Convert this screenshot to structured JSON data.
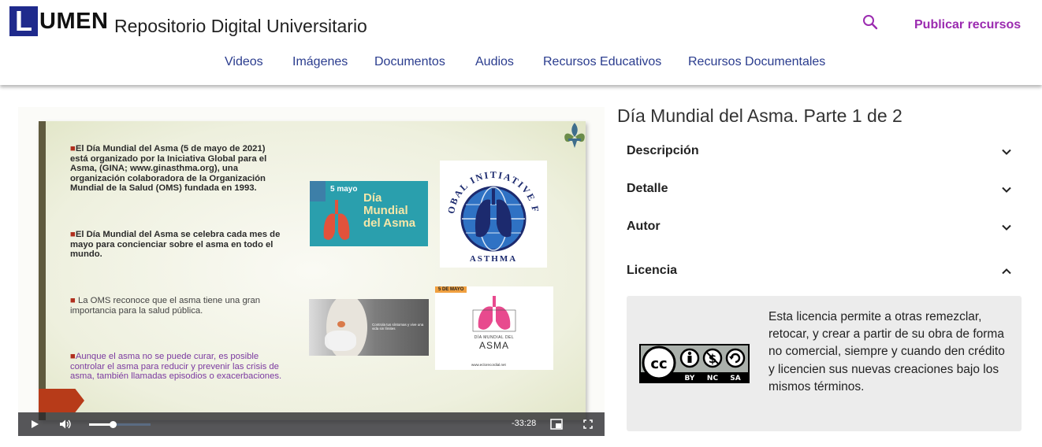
{
  "header": {
    "logo_letter": "L",
    "logo_rest": "UMEN",
    "site_title": "Repositorio Digital Universitario",
    "search_icon": "search-icon",
    "publish_label": "Publicar recursos",
    "brand_color": "#1f2a8c",
    "accent_color": "#9b2bb0"
  },
  "nav": {
    "items": [
      {
        "label": "Videos"
      },
      {
        "label": "Imágenes"
      },
      {
        "label": "Documentos"
      },
      {
        "label": "Audios"
      },
      {
        "label": "Recursos Educativos"
      },
      {
        "label": "Recursos Documentales"
      }
    ]
  },
  "video": {
    "slide": {
      "bullets": [
        "El Día Mundial del Asma (5 de mayo de 2021) está organizado por la Iniciativa Global para el Asma, (GINA; www.ginasthma.org), una organización colaboradora de la Organización Mundial de la Salud (OMS) fundada en 1993.",
        "El Día Mundial del Asma se celebra cada mes de mayo para concienciar sobre el asma en todo el mundo.",
        "La OMS reconoce que el asma tiene una gran importancia para la salud pública.",
        "Aunque el asma no se puede curar, es posible controlar el asma para reducir y prevenir las crisis de asma, también llamadas episodios o exacerbaciones."
      ],
      "poster_date": "5 mayo",
      "poster_title_1": "Día",
      "poster_title_2": "Mundial",
      "poster_title_3": "del Asma",
      "gina_top": "GLOBAL INITIATIVE FOR",
      "gina_bottom": "ASTHMA",
      "card_tag": "5 DE MAYO",
      "card_sub": "DÍA MUNDIAL DEL",
      "card_title": "ASMA",
      "card_footer": "www.eclorecordial.net",
      "photo_caption": "Controla tus síntomas y vive una vida sin límites"
    },
    "controls": {
      "play_icon": "play-icon",
      "volume_icon": "volume-icon",
      "volume_level": 0.38,
      "time_remaining": "-33:28",
      "pip_icon": "picture-in-picture-icon",
      "fullscreen_icon": "fullscreen-icon"
    }
  },
  "details": {
    "title": "Día Mundial del Asma. Parte 1 de 2",
    "sections": [
      {
        "label": "Descripción",
        "expanded": false
      },
      {
        "label": "Detalle",
        "expanded": false
      },
      {
        "label": "Autor",
        "expanded": false
      },
      {
        "label": "Licencia",
        "expanded": true
      }
    ],
    "license": {
      "badge_terms": [
        "BY",
        "NC",
        "SA"
      ],
      "text": "Esta licencia permite a otras remezclar, retocar, y crear a partir de su obra de forma no comercial, siempre y cuando den crédito y licencien sus nuevas creaciones bajo los mismos términos."
    }
  }
}
